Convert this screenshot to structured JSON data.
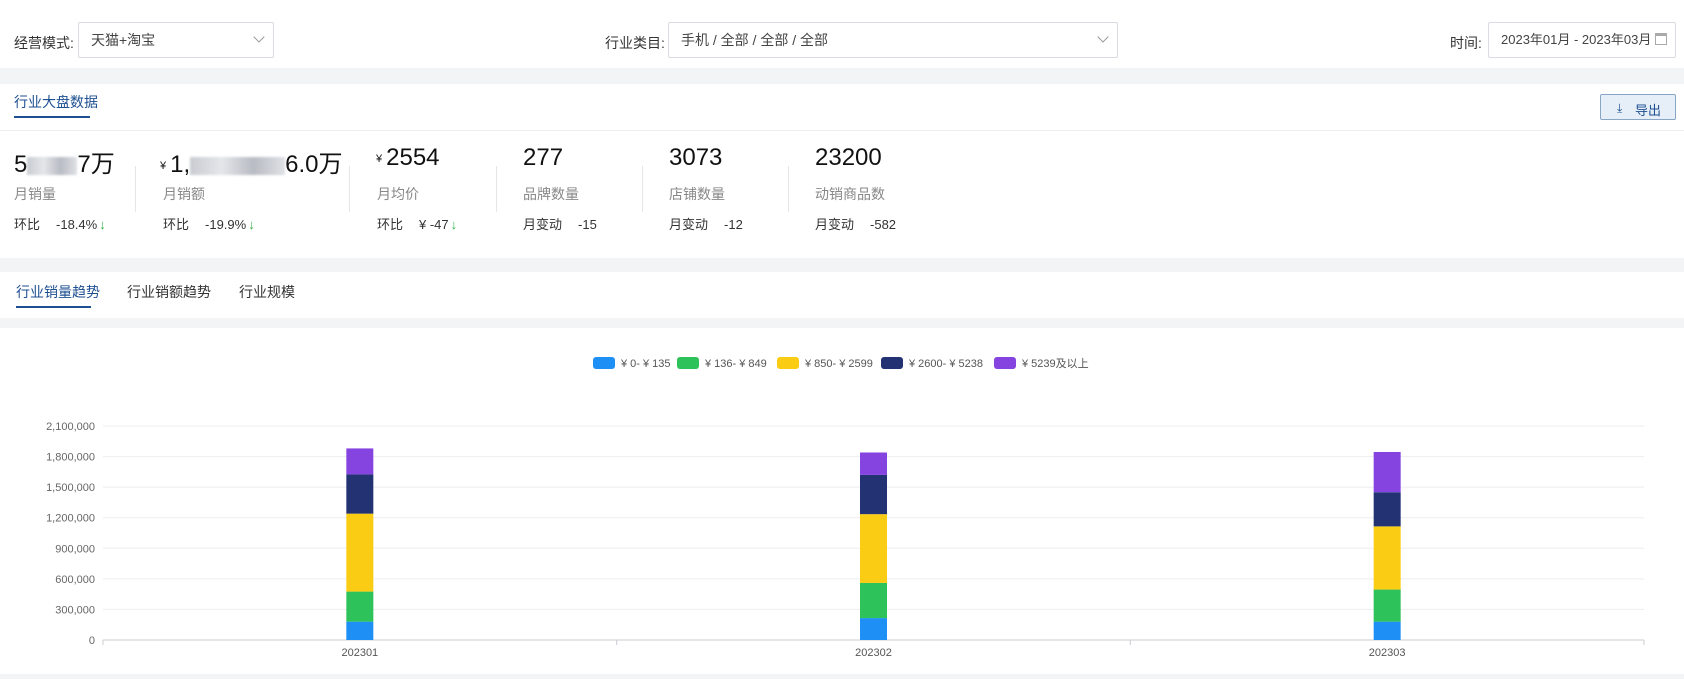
{
  "filters": {
    "mode_label": "经营模式:",
    "mode_value": "天猫+淘宝",
    "industry_label": "行业类目:",
    "industry_value": "手机 / 全部 / 全部 / 全部",
    "time_label": "时间:",
    "time_value": "2023年01月 - 2023年03月"
  },
  "stats_panel": {
    "tab": "行业大盘数据",
    "export_label": "导出",
    "export_icon": "download-icon",
    "items": [
      {
        "value_pre": "5",
        "value_post": "7万",
        "currency": "",
        "label": "月销量",
        "change_label": "环比",
        "change_value": "-18.4%",
        "arrow": "↓"
      },
      {
        "value_pre": "1,",
        "value_post": "6.0万",
        "currency": "¥",
        "label": "月销额",
        "change_label": "环比",
        "change_value": "-19.9%",
        "arrow": "↓"
      },
      {
        "value_pre": "2554",
        "value_post": "",
        "currency": "¥",
        "label": "月均价",
        "change_label": "环比",
        "change_value": "¥ -47",
        "arrow": "↓"
      },
      {
        "value_pre": "277",
        "value_post": "",
        "currency": "",
        "label": "品牌数量",
        "change_label": "月变动",
        "change_value": "-15",
        "arrow": ""
      },
      {
        "value_pre": "3073",
        "value_post": "",
        "currency": "",
        "label": "店铺数量",
        "change_label": "月变动",
        "change_value": "-12",
        "arrow": ""
      },
      {
        "value_pre": "23200",
        "value_post": "",
        "currency": "",
        "label": "动销商品数",
        "change_label": "月变动",
        "change_value": "-582",
        "arrow": ""
      }
    ]
  },
  "trend_tabs": {
    "active": "行业销量趋势",
    "tab2": "行业销额趋势",
    "tab3": "行业规模"
  },
  "chart_data": {
    "type": "bar",
    "stacked": true,
    "categories": [
      "202301",
      "202302",
      "202303"
    ],
    "series": [
      {
        "name": "¥ 0- ¥ 135",
        "color": "#1e90f5",
        "values": [
          180000,
          215000,
          180000
        ]
      },
      {
        "name": "¥ 136- ¥ 849",
        "color": "#2ec25b",
        "values": [
          295000,
          345000,
          315000
        ]
      },
      {
        "name": "¥ 850- ¥ 2599",
        "color": "#facc14",
        "values": [
          765000,
          675000,
          620000
        ]
      },
      {
        "name": "¥ 2600- ¥ 5238",
        "color": "#223273",
        "values": [
          385000,
          385000,
          335000
        ]
      },
      {
        "name": "¥ 5239及以上",
        "color": "#8543e0",
        "values": [
          255000,
          220000,
          395000
        ]
      }
    ],
    "yticks": [
      "0",
      "300,000",
      "600,000",
      "900,000",
      "1,200,000",
      "1,500,000",
      "1,800,000",
      "2,100,000"
    ],
    "ylim": [
      0,
      2100000
    ],
    "grid": true,
    "legend": "top-center"
  }
}
